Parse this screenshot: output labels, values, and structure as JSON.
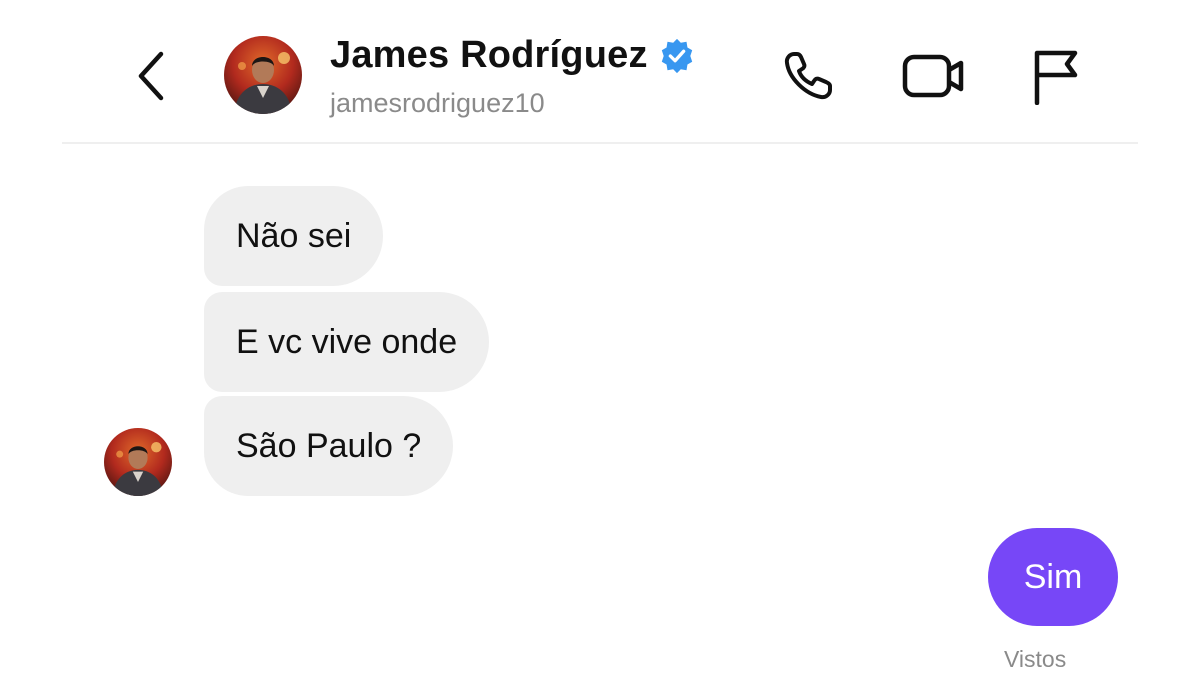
{
  "header": {
    "back_icon": "chevron-left-icon",
    "display_name": "James Rodríguez",
    "verified_icon": "verified-badge-icon",
    "username": "jamesrodriguez10",
    "actions": [
      "phone-icon",
      "video-camera-icon",
      "flag-icon"
    ]
  },
  "messages": [
    {
      "sender": "contact",
      "text": "Não sei"
    },
    {
      "sender": "contact",
      "text": "E vc vive onde"
    },
    {
      "sender": "contact",
      "text": "São Paulo ?"
    },
    {
      "sender": "me",
      "text": "Sim"
    }
  ],
  "status": {
    "seen_label": "Vistos"
  },
  "colors": {
    "accent": "#7747f7",
    "verified": "#3897f0",
    "incoming_bubble": "#efefef",
    "secondary_text": "#8a8a8a"
  }
}
